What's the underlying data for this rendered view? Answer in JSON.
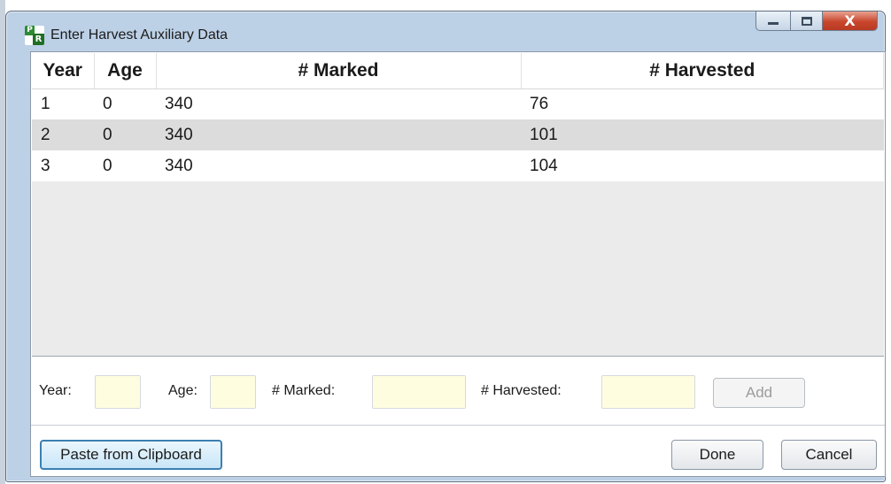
{
  "window": {
    "title": "Enter Harvest Auxiliary Data",
    "app_icon_letters": [
      "P",
      "R"
    ],
    "close_glyph": "X"
  },
  "grid": {
    "columns": [
      "Year",
      "Age",
      "# Marked",
      "# Harvested"
    ],
    "rows": [
      {
        "year": "1",
        "age": "0",
        "marked": "340",
        "harvested": "76"
      },
      {
        "year": "2",
        "age": "0",
        "marked": "340",
        "harvested": "101"
      },
      {
        "year": "3",
        "age": "0",
        "marked": "340",
        "harvested": "104"
      }
    ]
  },
  "entry": {
    "year_label": "Year:",
    "age_label": "Age:",
    "marked_label": "# Marked:",
    "harvested_label": "# Harvested:",
    "year_value": "",
    "age_value": "",
    "marked_value": "",
    "harvested_value": "",
    "add_label": "Add"
  },
  "footer": {
    "paste_label": "Paste from Clipboard",
    "done_label": "Done",
    "cancel_label": "Cancel"
  },
  "colors": {
    "input_background": "#fffde0",
    "selected_row": "#dcdcdc",
    "close_button": "#c8462c",
    "focused_button_border": "#3c7fb1"
  },
  "icons": [
    "minimize-icon",
    "maximize-icon",
    "close-icon",
    "app-logo-icon"
  ]
}
